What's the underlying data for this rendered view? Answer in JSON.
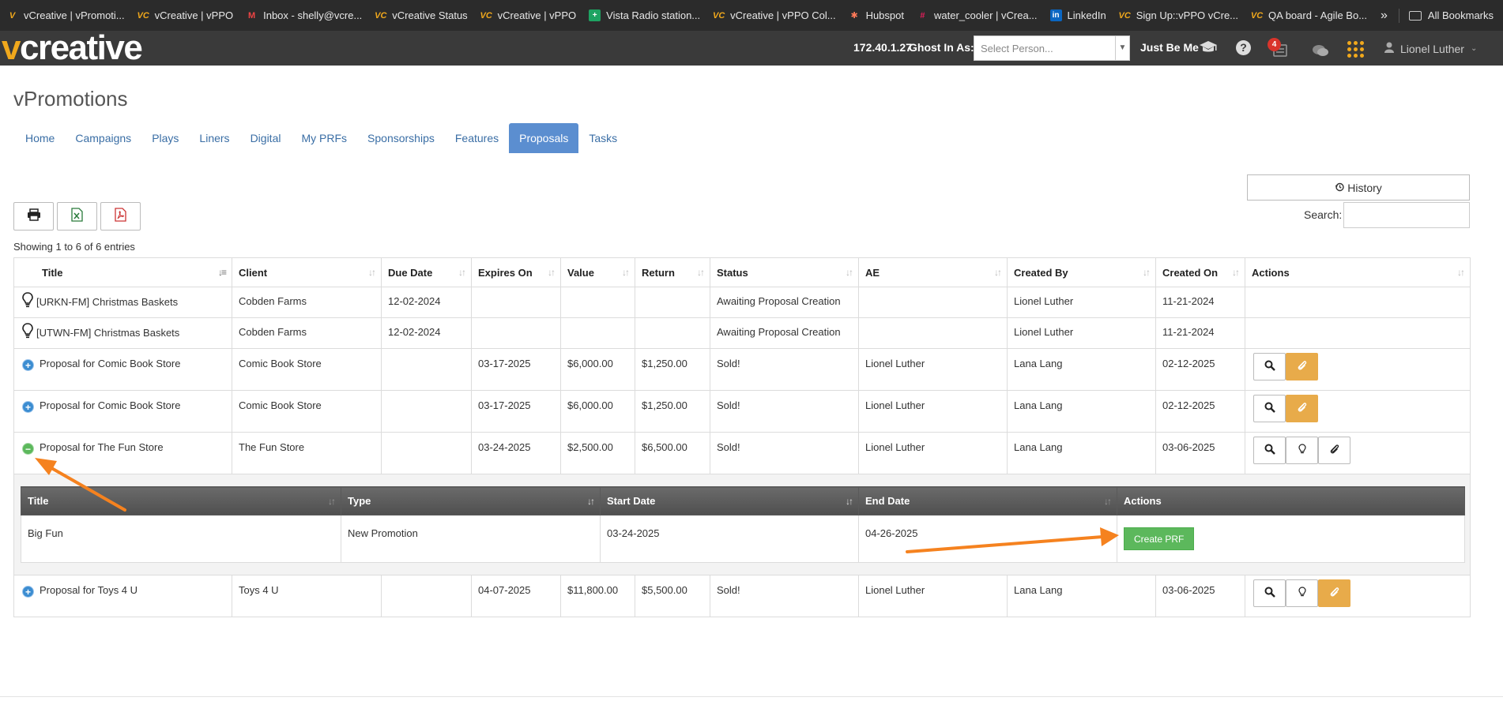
{
  "bookmarks": {
    "items": [
      {
        "label": "vCreative | vPromoti...",
        "icon": "vc-logo-icon"
      },
      {
        "label": "vCreative | vPPO",
        "icon": "vc-logo-icon"
      },
      {
        "label": "Inbox - shelly@vcre...",
        "icon": "gmail-icon"
      },
      {
        "label": "vCreative Status",
        "icon": "vc-logo-icon"
      },
      {
        "label": "vCreative | vPPO",
        "icon": "vc-logo-icon"
      },
      {
        "label": "Vista Radio station...",
        "icon": "sheets-icon"
      },
      {
        "label": "vCreative | vPPO Col...",
        "icon": "vc-logo-icon"
      },
      {
        "label": "Hubspot",
        "icon": "hubspot-icon"
      },
      {
        "label": "water_cooler | vCrea...",
        "icon": "slack-icon"
      },
      {
        "label": "LinkedIn",
        "icon": "linkedin-icon"
      },
      {
        "label": "Sign Up::vPPO vCre...",
        "icon": "vc-logo-icon"
      },
      {
        "label": "QA board - Agile Bo...",
        "icon": "vc-logo-icon"
      }
    ],
    "all_bookmarks": "All Bookmarks"
  },
  "header": {
    "logo_v": "v",
    "logo_rest": "creative",
    "ip": "172.40.1.27",
    "ghost_label": "Ghost In As:",
    "ghost_placeholder": "Select Person...",
    "just_be_me": "Just Be Me",
    "notification_count": "4",
    "user_name": "Lionel Luther"
  },
  "page": {
    "title": "vPromotions",
    "tabs": [
      "Home",
      "Campaigns",
      "Plays",
      "Liners",
      "Digital",
      "My PRFs",
      "Sponsorships",
      "Features",
      "Proposals",
      "Tasks"
    ],
    "active_tab": "Proposals"
  },
  "toolbar": {
    "history_label": "History",
    "search_label": "Search:",
    "showing": "Showing 1 to 6 of 6 entries"
  },
  "table": {
    "columns": [
      "Title",
      "Client",
      "Due Date",
      "Expires On",
      "Value",
      "Return",
      "Status",
      "AE",
      "Created By",
      "Created On",
      "Actions"
    ],
    "rows": [
      {
        "title": "[URKN-FM] Christmas Baskets",
        "client": "Cobden Farms",
        "due": "12-02-2024",
        "expires": "",
        "value": "",
        "return": "",
        "status": "Awaiting Proposal Creation",
        "ae": "",
        "created_by": "Lionel Luther",
        "created_on": "11-21-2024"
      },
      {
        "title": "[UTWN-FM] Christmas Baskets",
        "client": "Cobden Farms",
        "due": "12-02-2024",
        "expires": "",
        "value": "",
        "return": "",
        "status": "Awaiting Proposal Creation",
        "ae": "",
        "created_by": "Lionel Luther",
        "created_on": "11-21-2024"
      },
      {
        "title": "Proposal for Comic Book Store",
        "client": "Comic Book Store",
        "due": "",
        "expires": "03-17-2025",
        "value": "$6,000.00",
        "return": "$1,250.00",
        "status": "Sold!",
        "ae": "Lionel Luther",
        "created_by": "Lana Lang",
        "created_on": "02-12-2025"
      },
      {
        "title": "Proposal for Comic Book Store",
        "client": "Comic Book Store",
        "due": "",
        "expires": "03-17-2025",
        "value": "$6,000.00",
        "return": "$1,250.00",
        "status": "Sold!",
        "ae": "Lionel Luther",
        "created_by": "Lana Lang",
        "created_on": "02-12-2025"
      },
      {
        "title": "Proposal for The Fun Store",
        "client": "The Fun Store",
        "due": "",
        "expires": "03-24-2025",
        "value": "$2,500.00",
        "return": "$6,500.00",
        "status": "Sold!",
        "ae": "Lionel Luther",
        "created_by": "Lana Lang",
        "created_on": "03-06-2025"
      },
      {
        "title": "Proposal for Toys 4 U",
        "client": "Toys 4 U",
        "due": "",
        "expires": "04-07-2025",
        "value": "$11,800.00",
        "return": "$5,500.00",
        "status": "Sold!",
        "ae": "Lionel Luther",
        "created_by": "Lana Lang",
        "created_on": "03-06-2025"
      }
    ]
  },
  "subtable": {
    "columns": [
      "Title",
      "Type",
      "Start Date",
      "End Date",
      "Actions"
    ],
    "row": {
      "title": "Big Fun",
      "type": "New Promotion",
      "start": "03-24-2025",
      "end": "04-26-2025"
    },
    "create_label": "Create PRF"
  },
  "colors": {
    "accent_orange": "#f0a81c",
    "active_tab": "#5b8ed0",
    "create_green": "#5cb85c",
    "annotation_arrow": "#f5821f"
  }
}
